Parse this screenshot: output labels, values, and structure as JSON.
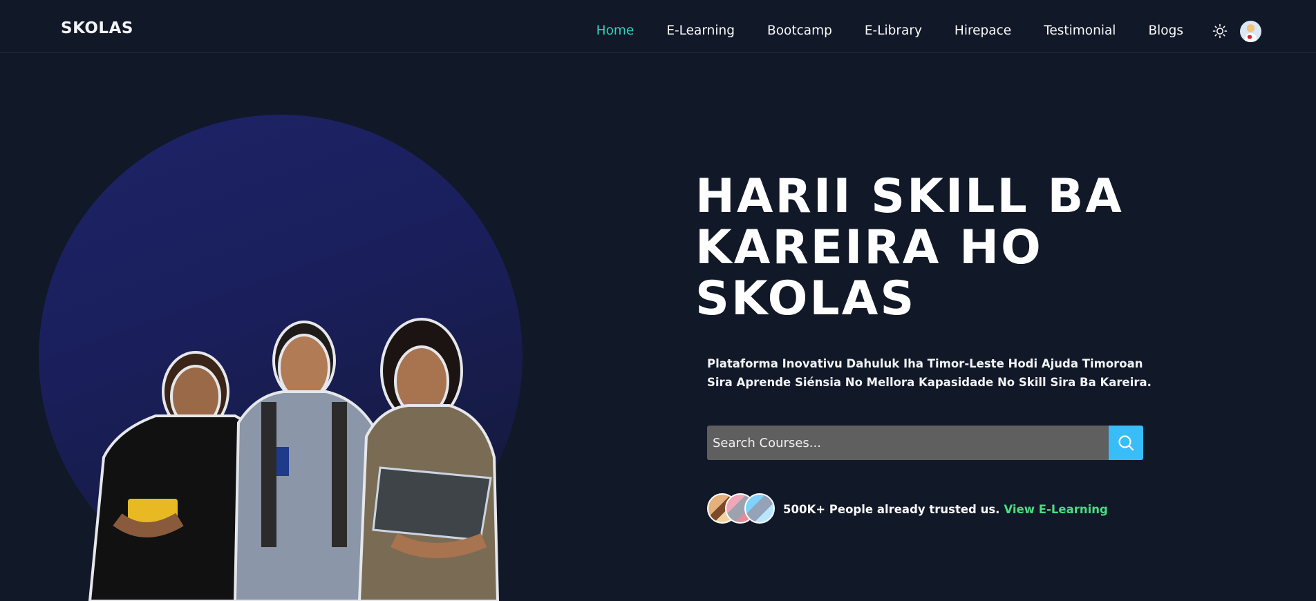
{
  "brand": {
    "logo": "SKOLAS"
  },
  "nav": {
    "items": [
      {
        "label": "Home",
        "active": true
      },
      {
        "label": "E-Learning"
      },
      {
        "label": "Bootcamp"
      },
      {
        "label": "E-Library"
      },
      {
        "label": "Hirepace"
      },
      {
        "label": "Testimonial"
      },
      {
        "label": "Blogs"
      }
    ],
    "icons": [
      "sun-icon",
      "user-avatar"
    ]
  },
  "hero": {
    "headline": "HARII SKILL BA\nKAREIRA HO\nSKOLAS",
    "tagline": "Plataforma Inovativu Dahuluk Iha Timor-Leste Hodi Ajuda Timoroan Sira Aprende Siénsia No Mellora Kapasidade No Skill Sira Ba Kareira.",
    "search": {
      "placeholder": "Search Courses...",
      "value": ""
    },
    "trust_text": "500K+ People already trusted us.",
    "trust_link": "View E-Learning"
  },
  "colors": {
    "background": "#111827",
    "active_nav": "#2dd4bf",
    "search_button": "#38bdf8",
    "link": "#4ade80",
    "hero_circle": "#1d2366"
  }
}
